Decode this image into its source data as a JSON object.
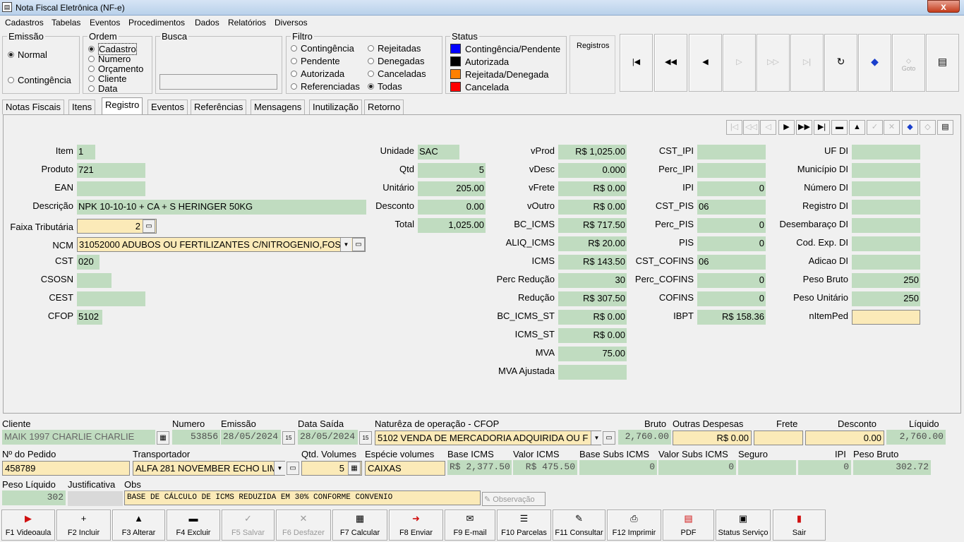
{
  "window": {
    "title": "Nota Fiscal Eletrônica (NF-e)",
    "close": "x"
  },
  "menu": [
    "Cadastros",
    "Tabelas",
    "Eventos",
    "Procedimentos",
    "Dados",
    "Relatórios",
    "Diversos"
  ],
  "emissao": {
    "title": "Emissão",
    "options": [
      "Normal",
      "Contingência"
    ],
    "selected": 0
  },
  "ordem": {
    "title": "Ordem",
    "options": [
      "Cadastro",
      "Numero",
      "Orçamento",
      "Cliente",
      "Data"
    ],
    "selected": 0
  },
  "busca": {
    "title": "Busca",
    "value": ""
  },
  "filtro": {
    "title": "Filtro",
    "col1": [
      "Contingência",
      "Pendente",
      "Autorizada",
      "Referenciadas"
    ],
    "col2": [
      "Rejeitadas",
      "Denegadas",
      "Canceladas",
      "Todas"
    ],
    "selected": "Todas"
  },
  "status": {
    "title": "Status",
    "items": [
      {
        "label": "Contingência/Pendente",
        "color": "#0000ff"
      },
      {
        "label": "Autorizada",
        "color": "#000000"
      },
      {
        "label": "Rejeitada/Denegada",
        "color": "#ff8000"
      },
      {
        "label": "Cancelada",
        "color": "#ff0000"
      }
    ]
  },
  "registros": {
    "label": "Registros"
  },
  "nav_icons": [
    "first-record-icon",
    "prev-page-icon",
    "prev-record-icon",
    "next-record-icon",
    "next-page-icon",
    "last-record-icon",
    "refresh-icon",
    "tag-icon",
    "goto-icon",
    "report-icon"
  ],
  "tabs": [
    "Notas Fiscais",
    "Itens",
    "Registro",
    "Eventos",
    "Referências",
    "Mensagens",
    "Inutilização",
    "Retorno"
  ],
  "active_tab": 2,
  "item": {
    "labels": {
      "item": "Item",
      "produto": "Produto",
      "ean": "EAN",
      "descricao": "Descrição",
      "faixa": "Faixa Tributária",
      "ncm": "NCM",
      "cst": "CST",
      "csosn": "CSOSN",
      "cest": "CEST",
      "cfop": "CFOP"
    },
    "values": {
      "item": "1",
      "produto": "721",
      "ean": "",
      "descricao": "NPK 10-10-10 + CA + S HERINGER 50KG",
      "faixa": "2",
      "ncm": "31052000 ADUBOS OU FERTILIZANTES C/NITROGENIO,FOS",
      "cst": "020",
      "csosn": "",
      "cest": "",
      "cfop": "5102"
    }
  },
  "col2": {
    "labels": [
      "Unidade",
      "Qtd",
      "Unitário",
      "Desconto",
      "Total"
    ],
    "values": [
      "SAC",
      "5",
      "205.00",
      "0.00",
      "1,025.00"
    ]
  },
  "col3": {
    "labels": [
      "vProd",
      "vDesc",
      "vFrete",
      "vOutro",
      "BC_ICMS",
      "ALIQ_ICMS",
      "ICMS",
      "Perc Redução",
      "Redução",
      "BC_ICMS_ST",
      "ICMS_ST",
      "MVA",
      "MVA Ajustada"
    ],
    "values": [
      "R$ 1,025.00",
      "0.000",
      "R$ 0.00",
      "R$ 0.00",
      "R$ 717.50",
      "R$ 20.00",
      "R$ 143.50",
      "30",
      "R$ 307.50",
      "R$ 0.00",
      "R$ 0.00",
      "75.00",
      ""
    ]
  },
  "col4": {
    "labels": [
      "CST_IPI",
      "Perc_IPI",
      "IPI",
      "CST_PIS",
      "Perc_PIS",
      "PIS",
      "CST_COFINS",
      "Perc_COFINS",
      "COFINS",
      "IBPT"
    ],
    "values": [
      "",
      "",
      "0",
      "06",
      "0",
      "0",
      "06",
      "0",
      "0",
      "R$ 158.36"
    ]
  },
  "col5": {
    "labels": [
      "UF DI",
      "Município DI",
      "Número DI",
      "Registro DI",
      "Desembaraço DI",
      "Cod. Exp. DI",
      "Adicao DI",
      "Peso Bruto",
      "Peso Unitário",
      "nItemPed"
    ],
    "values": [
      "",
      "",
      "",
      "",
      "",
      "",
      "",
      "250",
      "250",
      ""
    ]
  },
  "footer": {
    "cliente": {
      "label": "Cliente",
      "value": "MAIK 1997 CHARLIE CHARLIE"
    },
    "numero": {
      "label": "Numero",
      "value": "53856"
    },
    "emissao": {
      "label": "Emissão",
      "value": "28/05/2024"
    },
    "data_saida": {
      "label": "Data Saída",
      "value": "28/05/2024"
    },
    "natureza": {
      "label": "Naturêza de operação - CFOP",
      "value": "5102 VENDA DE MERCADORIA ADQUIRIDA OU F"
    },
    "bruto": {
      "label": "Bruto",
      "value": "2,760.00"
    },
    "outras": {
      "label": "Outras Despesas",
      "value": "R$ 0.00"
    },
    "frete": {
      "label": "Frete",
      "value": ""
    },
    "desconto": {
      "label": "Desconto",
      "value": "0.00"
    },
    "liquido": {
      "label": "Líquido",
      "value": "2,760.00"
    },
    "pedido": {
      "label": "Nº do Pedido",
      "value": "458789"
    },
    "transportador": {
      "label": "Transportador",
      "value": "ALFA 281 NOVEMBER ECHO LIM"
    },
    "qtd_volumes": {
      "label": "Qtd. Volumes",
      "value": "5"
    },
    "especie": {
      "label": "Espécie volumes",
      "value": "CAIXAS"
    },
    "base_icms": {
      "label": "Base ICMS",
      "value": "R$ 2,377.50"
    },
    "valor_icms": {
      "label": "Valor ICMS",
      "value": "R$ 475.50"
    },
    "base_subs": {
      "label": "Base Subs ICMS",
      "value": "0"
    },
    "valor_subs": {
      "label": "Valor Subs ICMS",
      "value": "0"
    },
    "seguro": {
      "label": "Seguro",
      "value": ""
    },
    "ipi": {
      "label": "IPI",
      "value": "0"
    },
    "peso_bruto": {
      "label": "Peso Bruto",
      "value": "302.72"
    },
    "peso_liquido": {
      "label": "Peso Líquido",
      "value": "302"
    },
    "justificativa": {
      "label": "Justificativa",
      "value": ""
    },
    "obs": {
      "label": "Obs",
      "value": "BASE DE CÁLCULO DE ICMS REDUZIDA EM  30%  CONFORME  CONVENIO"
    },
    "observacao_btn": "Observação"
  },
  "fkeys": [
    {
      "label": "F1 Videoaula",
      "icon": "▶",
      "enabled": true
    },
    {
      "label": "F2 Incluir",
      "icon": "+",
      "enabled": true
    },
    {
      "label": "F3 Alterar",
      "icon": "▲",
      "enabled": true
    },
    {
      "label": "F4 Excluir",
      "icon": "▬",
      "enabled": true
    },
    {
      "label": "F5 Salvar",
      "icon": "✓",
      "enabled": false
    },
    {
      "label": "F6 Desfazer",
      "icon": "✕",
      "enabled": false
    },
    {
      "label": "F7 Calcular",
      "icon": "▦",
      "enabled": true
    },
    {
      "label": "F8 Enviar",
      "icon": "➜",
      "enabled": true
    },
    {
      "label": "F9 E-mail",
      "icon": "✉",
      "enabled": true
    },
    {
      "label": "F10 Parcelas",
      "icon": "☰",
      "enabled": true
    },
    {
      "label": "F11 Consultar",
      "icon": "✎",
      "enabled": true
    },
    {
      "label": "F12 Imprimir",
      "icon": "⎙",
      "enabled": true
    },
    {
      "label": "PDF",
      "icon": "▤",
      "enabled": true
    },
    {
      "label": "Status Serviço",
      "icon": "▣",
      "enabled": true
    },
    {
      "label": "Sair",
      "icon": "▮",
      "enabled": true
    }
  ]
}
